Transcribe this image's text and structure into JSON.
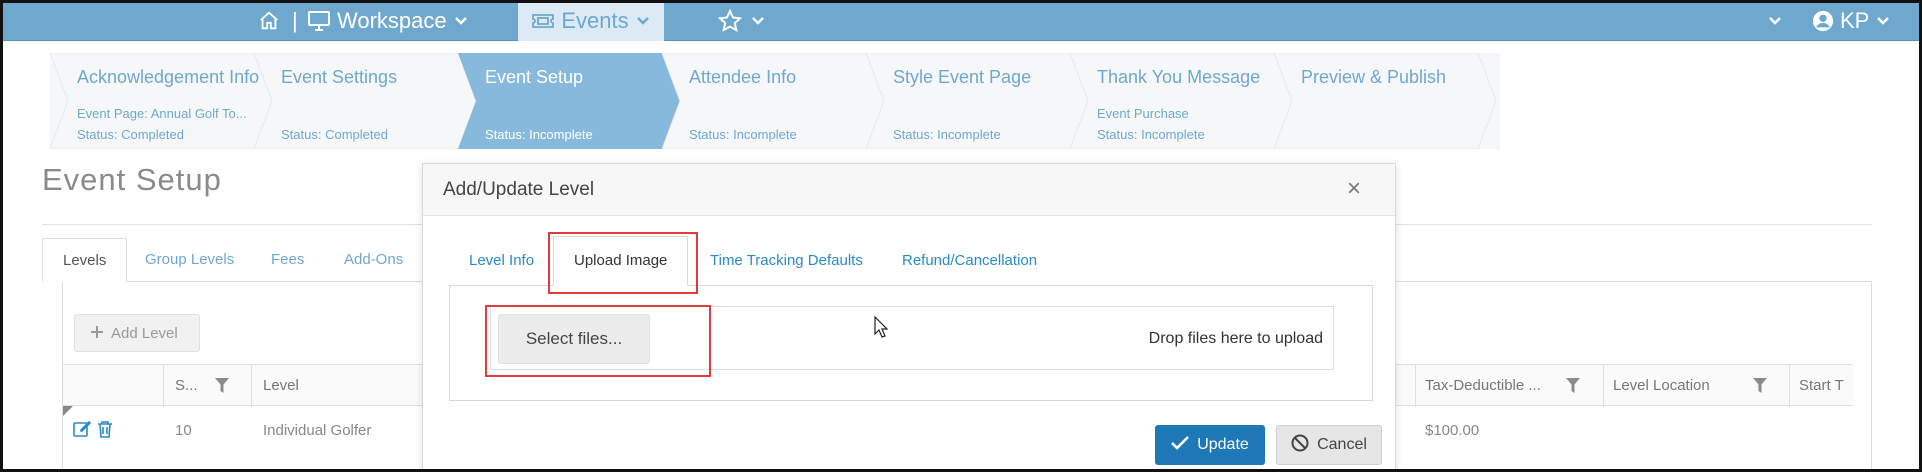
{
  "topnav": {
    "workspace_label": "Workspace",
    "separator": "|",
    "events_label": "Events",
    "user_initials": "KP"
  },
  "steps": [
    {
      "title": "Acknowledgement Info",
      "subtitle": "Event Page: Annual Golf To...",
      "status": "Status: Completed"
    },
    {
      "title": "Event Settings",
      "subtitle": "",
      "status": "Status: Completed"
    },
    {
      "title": "Event Setup",
      "subtitle": "",
      "status": "Status: Incomplete"
    },
    {
      "title": "Attendee Info",
      "subtitle": "",
      "status": "Status: Incomplete"
    },
    {
      "title": "Style Event Page",
      "subtitle": "",
      "status": "Status: Incomplete"
    },
    {
      "title": "Thank You Message",
      "subtitle": "Event Purchase",
      "status": "Status: Incomplete"
    },
    {
      "title": "Preview & Publish",
      "subtitle": "",
      "status": ""
    }
  ],
  "page": {
    "title": "Event Setup",
    "tabs": [
      "Levels",
      "Group Levels",
      "Fees",
      "Add-Ons"
    ],
    "add_level_label": "Add Level"
  },
  "grid": {
    "columns": [
      "S...",
      "Level",
      "Tax-Deductible ...",
      "Level Location",
      "Start T"
    ],
    "row": {
      "sort": "10",
      "level": "Individual Golfer",
      "tax_deductible": "$100.00"
    }
  },
  "modal": {
    "title": "Add/Update Level",
    "close_symbol": "×",
    "tabs": [
      "Level Info",
      "Upload Image",
      "Time Tracking Defaults",
      "Refund/Cancellation"
    ],
    "active_tab": "Upload Image",
    "select_files_label": "Select files...",
    "drop_hint": "Drop files here to upload",
    "update_label": "Update",
    "cancel_label": "Cancel"
  },
  "colors": {
    "nav_bg": "#6fa8cf",
    "accent": "#2b8ac7",
    "primary_button": "#1e78b8",
    "highlight": "#e03c3c"
  },
  "icons": [
    "home-icon",
    "monitor-icon",
    "chevron-down-icon",
    "ticket-icon",
    "star-icon",
    "user-icon",
    "plus-icon",
    "filter-icon",
    "edit-icon",
    "trash-icon",
    "check-icon",
    "ban-icon",
    "close-icon"
  ]
}
